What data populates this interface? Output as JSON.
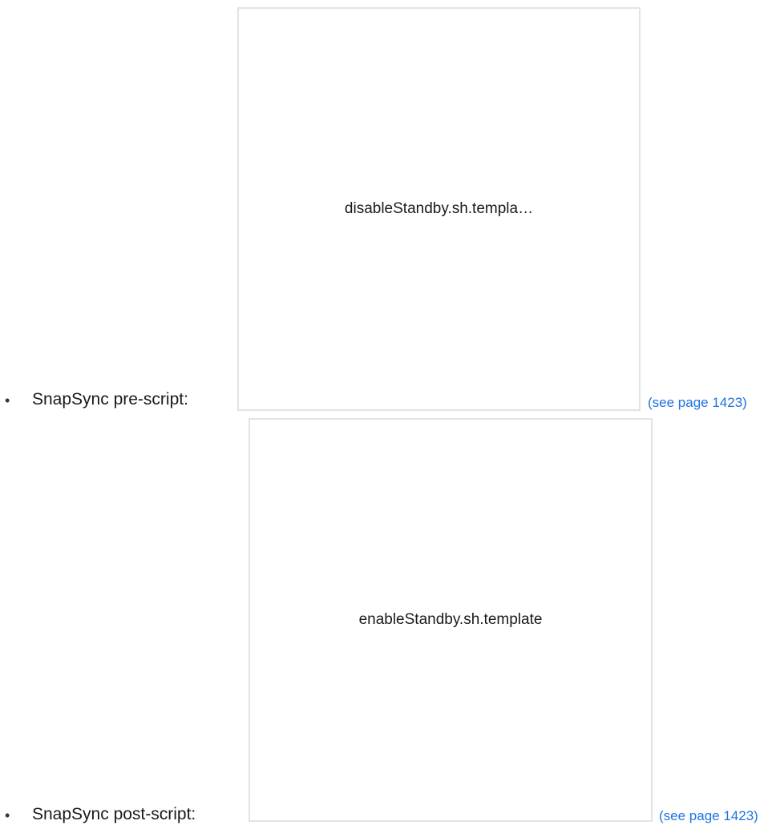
{
  "items": [
    {
      "bullet": "•",
      "label": "SnapSync pre-script:",
      "attachment_name": "disableStandby.sh.templa…",
      "link_text": "(see page 1423)"
    },
    {
      "bullet": "•",
      "label": "SnapSync post-script:",
      "attachment_name": "enableStandby.sh.template",
      "link_text": "(see page 1423)"
    }
  ],
  "colors": {
    "link": "#1e73e0",
    "border": "#e3e3e3",
    "text": "#1a1a1a"
  }
}
